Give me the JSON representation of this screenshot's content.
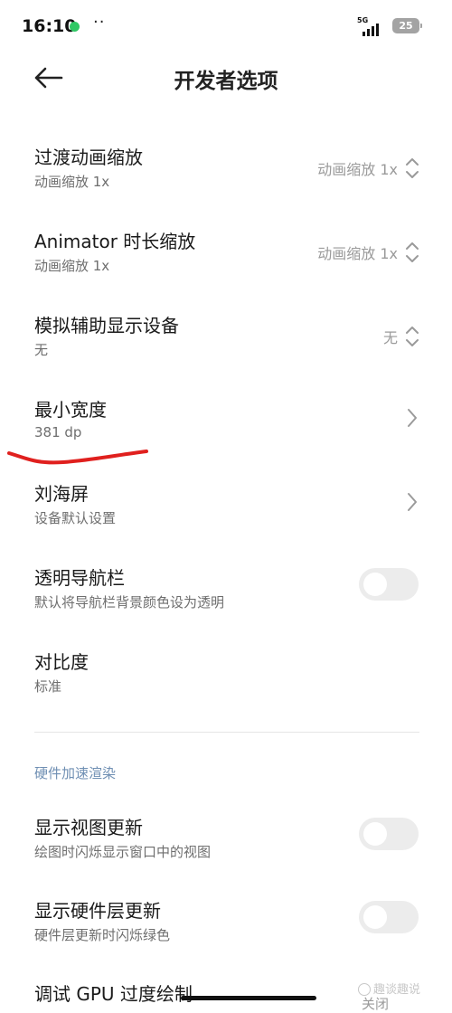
{
  "status_bar": {
    "time": "16:10",
    "more": "··",
    "network": "5G",
    "battery": "25"
  },
  "header": {
    "title": "开发者选项"
  },
  "settings": [
    {
      "title": "过渡动画缩放",
      "subtitle": "动画缩放 1x",
      "value": "动画缩放 1x",
      "control": "updown-icon"
    },
    {
      "title": "Animator 时长缩放",
      "subtitle": "动画缩放 1x",
      "value": "动画缩放 1x",
      "control": "updown-icon"
    },
    {
      "title": "模拟辅助显示设备",
      "subtitle": "无",
      "value": "无",
      "control": "updown-icon"
    },
    {
      "title": "最小宽度",
      "subtitle": "381 dp",
      "control": "chevron-right-icon"
    },
    {
      "title": "刘海屏",
      "subtitle": "设备默认设置",
      "control": "chevron-right-icon"
    },
    {
      "title": "透明导航栏",
      "subtitle": "默认将导航栏背景颜色设为透明",
      "control": "toggle",
      "enabled": false
    },
    {
      "title": "对比度",
      "subtitle": "标准"
    }
  ],
  "section": {
    "header": "硬件加速渲染",
    "items": [
      {
        "title": "显示视图更新",
        "subtitle": "绘图时闪烁显示窗口中的视图",
        "control": "toggle",
        "enabled": false
      },
      {
        "title": "显示硬件层更新",
        "subtitle": "硬件层更新时闪烁绿色",
        "control": "toggle",
        "enabled": false
      },
      {
        "title": "调试 GPU 过度绘制",
        "value": "关闭",
        "control": "updown-icon"
      }
    ]
  },
  "watermark": "趣谈趣说",
  "colors": {
    "accent_section": "#6f8fb3",
    "annotation": "#e0201e",
    "status_dot": "#2fc864"
  }
}
